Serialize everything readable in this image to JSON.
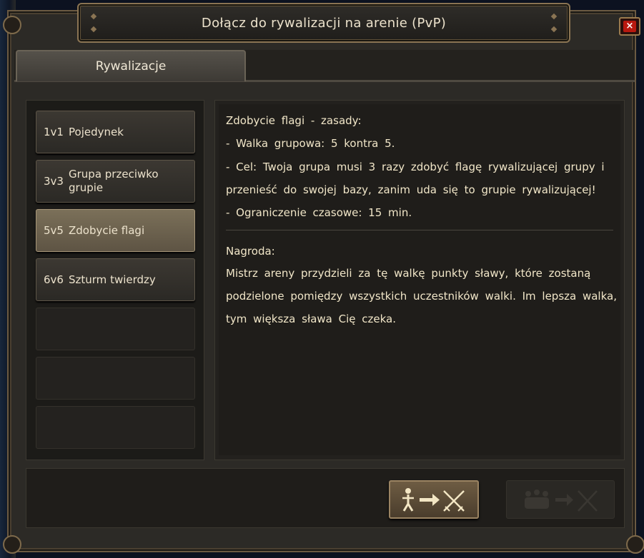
{
  "window": {
    "title": "Dołącz do rywalizacji na arenie (PvP)",
    "close_label": "×"
  },
  "tabs": [
    {
      "label": "Rywalizacje",
      "active": true
    }
  ],
  "modes": [
    {
      "code": "1v1",
      "name": "Pojedynek",
      "selected": false
    },
    {
      "code": "3v3",
      "name": "Grupa przeciwko grupie",
      "selected": false
    },
    {
      "code": "5v5",
      "name": "Zdobycie flagi",
      "selected": true
    },
    {
      "code": "6v6",
      "name": "Szturm twierdzy",
      "selected": false
    }
  ],
  "details": {
    "rules_heading": "Zdobycie flagi - zasady:",
    "rules": [
      "- Walka grupowa: 5 kontra 5.",
      "- Cel: Twoja grupa musi 3 razy zdobyć flagę rywalizującej grupy i",
      "przenieść do swojej bazy, zanim uda się to grupie rywalizującej!",
      "- Ograniczenie czasowe: 15 min."
    ],
    "reward_heading": "Nagroda:",
    "reward": [
      "Mistrz areny przydzieli za tę walkę punkty sławy, które zostaną",
      "podzielone pomiędzy wszystkich uczestników walki. Im lepsza walka,",
      "tym większa sława Cię czeka."
    ]
  },
  "actions": {
    "join_solo_icon": "single-person-to-swords-icon",
    "join_group_icon": "group-to-swords-icon",
    "join_group_enabled": false
  },
  "colors": {
    "text": "#f1e6c8",
    "selected_mode": "#7b7059",
    "close_red": "#b8180f"
  }
}
